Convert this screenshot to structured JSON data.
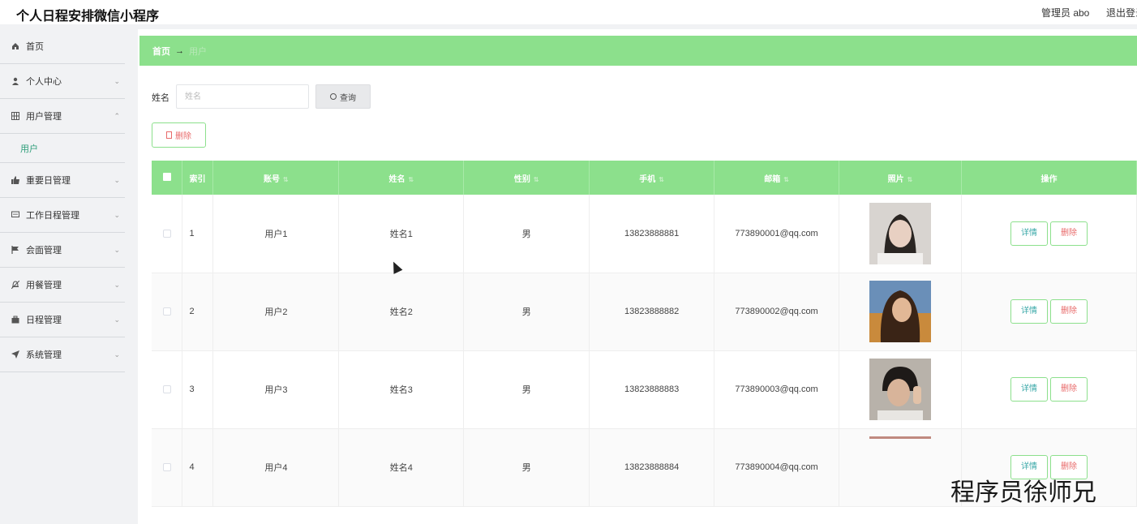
{
  "app": {
    "title": "个人日程安排微信小程序"
  },
  "header": {
    "admin": "管理员 abo",
    "logout": "退出登录"
  },
  "sidebar": {
    "items": [
      {
        "label": "首页",
        "icon": "home-icon",
        "chevron": ""
      },
      {
        "label": "个人中心",
        "icon": "user-icon",
        "chevron": "⌄"
      },
      {
        "label": "用户管理",
        "icon": "grid-icon",
        "chevron": "⌃"
      },
      {
        "label": "重要日管理",
        "icon": "thumb-icon",
        "chevron": "⌄"
      },
      {
        "label": "工作日程管理",
        "icon": "chat-icon",
        "chevron": "⌄"
      },
      {
        "label": "会面管理",
        "icon": "flag-icon",
        "chevron": "⌄"
      },
      {
        "label": "用餐管理",
        "icon": "bell-icon",
        "chevron": "⌄"
      },
      {
        "label": "日程管理",
        "icon": "briefcase-icon",
        "chevron": "⌄"
      },
      {
        "label": "系统管理",
        "icon": "send-icon",
        "chevron": "⌄"
      }
    ],
    "sub": {
      "label": "用户"
    }
  },
  "breadcrumb": {
    "home": "首页",
    "arrow": "→",
    "current": "用户"
  },
  "search": {
    "label": "姓名",
    "placeholder": "姓名",
    "button": "查询"
  },
  "toolbar": {
    "delete": "删除"
  },
  "table": {
    "headers": {
      "index": "索引",
      "account": "账号",
      "name": "姓名",
      "gender": "性别",
      "phone": "手机",
      "email": "邮箱",
      "photo": "照片",
      "actions": "操作"
    },
    "rows": [
      {
        "index": "1",
        "account": "用户1",
        "name": "姓名1",
        "gender": "男",
        "phone": "13823888881",
        "email": "773890001@qq.com"
      },
      {
        "index": "2",
        "account": "用户2",
        "name": "姓名2",
        "gender": "男",
        "phone": "13823888882",
        "email": "773890002@qq.com"
      },
      {
        "index": "3",
        "account": "用户3",
        "name": "姓名3",
        "gender": "男",
        "phone": "13823888883",
        "email": "773890003@qq.com"
      },
      {
        "index": "4",
        "account": "用户4",
        "name": "姓名4",
        "gender": "男",
        "phone": "13823888884",
        "email": "773890004@qq.com"
      }
    ],
    "detail_label": "详情",
    "delete_label": "删除"
  },
  "watermark": "程序员徐师兄",
  "colors": {
    "accent": "#8ce08c",
    "danger": "#e86a6a",
    "link": "#3aa8a8"
  }
}
